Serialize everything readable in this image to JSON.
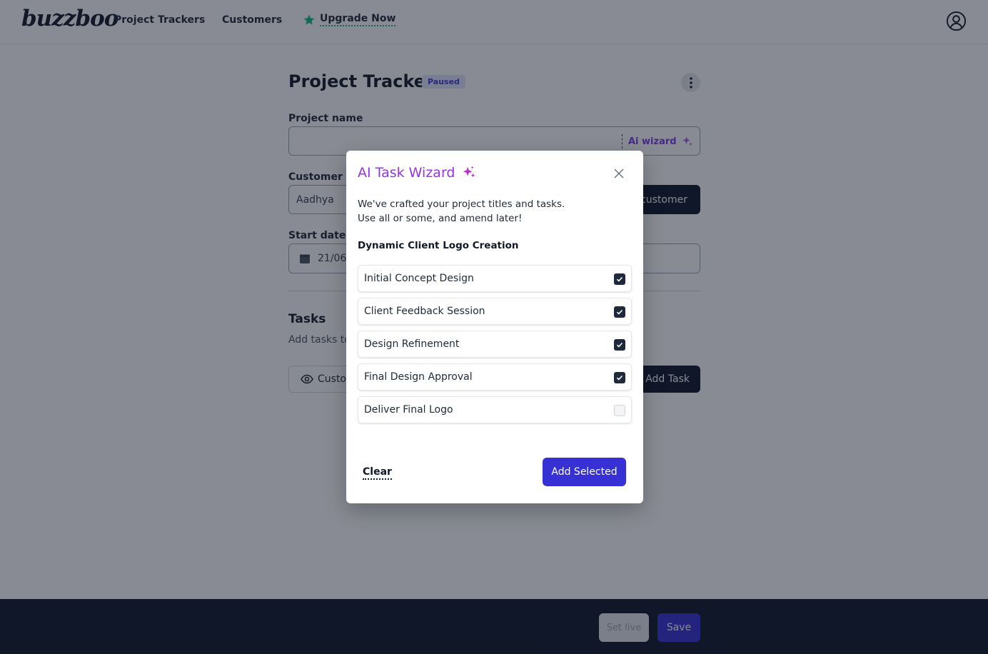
{
  "nav": {
    "logo": "buzzboo",
    "links": [
      "Project Trackers",
      "Customers"
    ],
    "upgrade_label": "Upgrade Now",
    "upgrade_icon": "star-icon",
    "account_icon": "user-circle-icon"
  },
  "page": {
    "title": "Project Tracker",
    "status": "Paused",
    "project_name_label": "Project name",
    "project_name_value": "",
    "ai_wizard_label": "Ai wizard",
    "customer_label": "Customer",
    "customer_value": "Aadhya",
    "add_customer_label": "customer",
    "start_date_label": "Start date",
    "start_date_value": "21/06/",
    "tasks_heading": "Tasks",
    "tasks_sub": "Add tasks to",
    "preview_label": "Custo",
    "add_task_label": "Add Task"
  },
  "footer": {
    "set_live_label": "Set live",
    "save_label": "Save"
  },
  "modal": {
    "title": "AI Task Wizard",
    "description_line1": "We've crafted your project titles and tasks.",
    "description_line2": "Use all or some, and amend later!",
    "project_title": "Dynamic Client Logo Creation",
    "tasks": [
      {
        "label": "Initial Concept Design",
        "checked": true
      },
      {
        "label": "Client Feedback Session",
        "checked": true
      },
      {
        "label": "Design Refinement",
        "checked": true
      },
      {
        "label": "Final Design Approval",
        "checked": true
      },
      {
        "label": "Deliver Final Logo",
        "checked": false
      }
    ],
    "clear_label": "Clear",
    "add_selected_label": "Add Selected"
  },
  "colors": {
    "accent": "#3730d4",
    "wizard_purple": "#9333ea",
    "dark": "#0f172a",
    "upgrade_green": "#10b981"
  }
}
